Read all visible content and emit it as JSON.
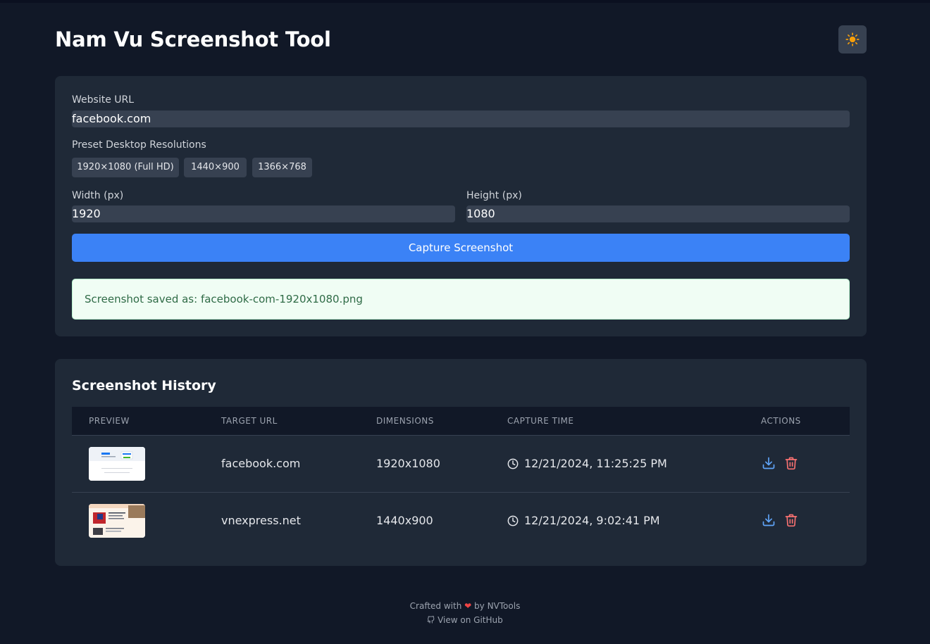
{
  "app": {
    "title": "Nam Vu Screenshot Tool",
    "theme_toggle_icon": "sun-icon",
    "accent_color": "#3b82f6"
  },
  "form": {
    "url_label": "Website URL",
    "url_value": "facebook.com",
    "presets_label": "Preset Desktop Resolutions",
    "presets": [
      "1920×1080 (Full HD)",
      "1440×900",
      "1366×768"
    ],
    "width_label": "Width (px)",
    "width_value": "1920",
    "height_label": "Height (px)",
    "height_value": "1080",
    "capture_label": "Capture Screenshot",
    "success_message": "Screenshot saved as: facebook-com-1920x1080.png"
  },
  "history": {
    "title": "Screenshot History",
    "columns": [
      "PREVIEW",
      "TARGET URL",
      "DIMENSIONS",
      "CAPTURE TIME",
      "ACTIONS"
    ],
    "rows": [
      {
        "url": "facebook.com",
        "dimensions": "1920x1080",
        "time": "12/21/2024, 11:25:25 PM"
      },
      {
        "url": "vnexpress.net",
        "dimensions": "1440x900",
        "time": "12/21/2024, 9:02:41 PM"
      }
    ]
  },
  "footer": {
    "crafted_prefix": "Crafted with",
    "heart": "❤",
    "crafted_suffix": "by NVTools",
    "github_label": "View on GitHub"
  }
}
